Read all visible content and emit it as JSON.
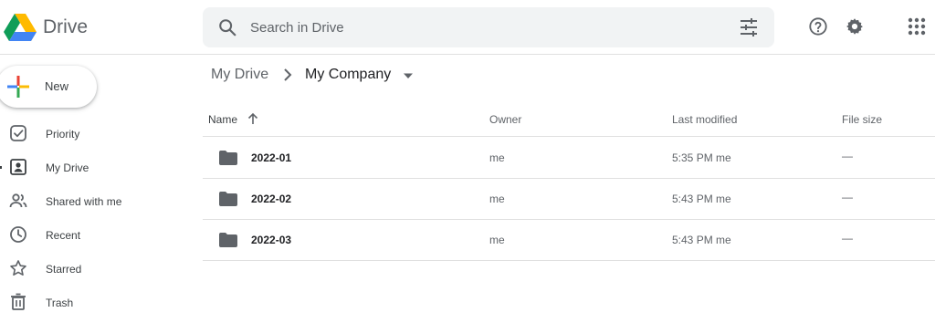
{
  "header": {
    "app_name": "Drive",
    "search": {
      "placeholder": "Search in Drive"
    },
    "icons": [
      "drive-logo",
      "search-icon",
      "tune-icon",
      "help-icon",
      "gear-icon",
      "apps-grid-icon"
    ]
  },
  "sidebar": {
    "new_label": "New",
    "items": [
      {
        "label": "Priority",
        "icon": "priority-check-icon"
      },
      {
        "label": "My Drive",
        "icon": "my-drive-icon"
      },
      {
        "label": "Shared with me",
        "icon": "shared-people-icon"
      },
      {
        "label": "Recent",
        "icon": "clock-icon"
      },
      {
        "label": "Starred",
        "icon": "star-icon"
      },
      {
        "label": "Trash",
        "icon": "trash-icon"
      }
    ]
  },
  "breadcrumb": {
    "root": "My Drive",
    "current": "My Company"
  },
  "table": {
    "headers": {
      "name": "Name",
      "owner": "Owner",
      "modified": "Last modified",
      "size": "File size"
    },
    "rows": [
      {
        "name": "2022-01",
        "owner": "me",
        "time": "5:35 PM",
        "by": "me",
        "size": "—"
      },
      {
        "name": "2022-02",
        "owner": "me",
        "time": "5:43 PM",
        "by": "me",
        "size": "—"
      },
      {
        "name": "2022-03",
        "owner": "me",
        "time": "5:43 PM",
        "by": "me",
        "size": "—"
      }
    ]
  },
  "colors": {
    "search_bg": "#f1f3f4",
    "divider": "#e0e0e0",
    "text_primary": "#202124",
    "text_secondary": "#5f6368",
    "icon": "#5f6368"
  }
}
